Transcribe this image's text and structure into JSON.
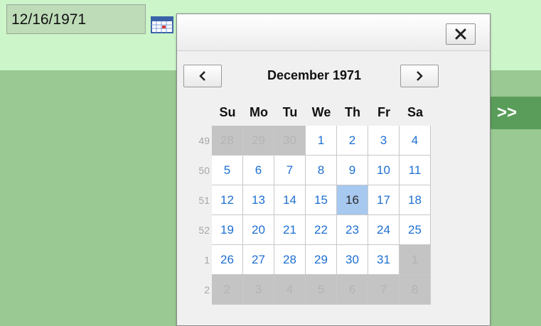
{
  "date_input": {
    "value": "12/16/1971"
  },
  "icons": {
    "calendar": "calendar-icon",
    "close": "close-icon",
    "prev": "chevron-left-icon",
    "next": "chevron-right-icon"
  },
  "next_button": {
    "label": ">>"
  },
  "calendar": {
    "title": "December 1971",
    "days_of_week": [
      "Su",
      "Mo",
      "Tu",
      "We",
      "Th",
      "Fr",
      "Sa"
    ],
    "weeks": [
      {
        "week": "49",
        "days": [
          {
            "d": "28",
            "in": false
          },
          {
            "d": "29",
            "in": false
          },
          {
            "d": "30",
            "in": false
          },
          {
            "d": "1",
            "in": true
          },
          {
            "d": "2",
            "in": true
          },
          {
            "d": "3",
            "in": true
          },
          {
            "d": "4",
            "in": true
          }
        ]
      },
      {
        "week": "50",
        "days": [
          {
            "d": "5",
            "in": true
          },
          {
            "d": "6",
            "in": true
          },
          {
            "d": "7",
            "in": true
          },
          {
            "d": "8",
            "in": true
          },
          {
            "d": "9",
            "in": true
          },
          {
            "d": "10",
            "in": true
          },
          {
            "d": "11",
            "in": true
          }
        ]
      },
      {
        "week": "51",
        "days": [
          {
            "d": "12",
            "in": true
          },
          {
            "d": "13",
            "in": true
          },
          {
            "d": "14",
            "in": true
          },
          {
            "d": "15",
            "in": true
          },
          {
            "d": "16",
            "in": true,
            "selected": true
          },
          {
            "d": "17",
            "in": true
          },
          {
            "d": "18",
            "in": true
          }
        ]
      },
      {
        "week": "52",
        "days": [
          {
            "d": "19",
            "in": true
          },
          {
            "d": "20",
            "in": true
          },
          {
            "d": "21",
            "in": true
          },
          {
            "d": "22",
            "in": true
          },
          {
            "d": "23",
            "in": true
          },
          {
            "d": "24",
            "in": true
          },
          {
            "d": "25",
            "in": true
          }
        ]
      },
      {
        "week": "1",
        "days": [
          {
            "d": "26",
            "in": true
          },
          {
            "d": "27",
            "in": true
          },
          {
            "d": "28",
            "in": true
          },
          {
            "d": "29",
            "in": true
          },
          {
            "d": "30",
            "in": true
          },
          {
            "d": "31",
            "in": true
          },
          {
            "d": "1",
            "in": false
          }
        ]
      },
      {
        "week": "2",
        "days": [
          {
            "d": "2",
            "in": false
          },
          {
            "d": "3",
            "in": false
          },
          {
            "d": "4",
            "in": false
          },
          {
            "d": "5",
            "in": false
          },
          {
            "d": "6",
            "in": false
          },
          {
            "d": "7",
            "in": false
          },
          {
            "d": "8",
            "in": false
          }
        ]
      }
    ]
  },
  "colors": {
    "page_bg": "#9ac994",
    "top_band": "#ccf5c9",
    "date_link": "#1e6fd0",
    "selected_day": "#a7c8ef",
    "other_month_bg": "#c4c4c4",
    "next_button_bg": "#5a9d5a"
  }
}
